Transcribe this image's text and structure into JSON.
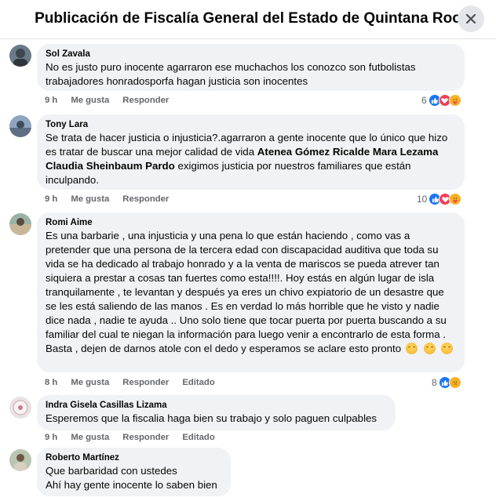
{
  "header": {
    "title": "Publicación de Fiscalía General del Estado de Quintana Roo"
  },
  "actions": {
    "like": "Me gusta",
    "reply": "Responder",
    "edited": "Editado"
  },
  "comments": [
    {
      "author": "Sol Zavala",
      "text": "No es justo puro inocente agarraron ese muchachos los conozco son futbolistas trabajadores honradosporfa hagan justicia son inocentes",
      "time": "9 h",
      "reaction_count": "6",
      "reactions": [
        "like-icon",
        "love-icon",
        "care-icon"
      ]
    },
    {
      "author": "Tony Lara",
      "text_before": "Se trata de hacer justicia o injusticia?.agarraron a gente inocente que lo único que hizo es tratar de buscar una mejor calidad de vida ",
      "mention1": "Atenea Gómez Ricalde",
      "mention2": "Mara Lezama",
      "mention3": "Claudia Sheinbaum Pardo",
      "text_after": " exigimos justicia por nuestros familiares que están inculpando.",
      "time": "9 h",
      "reaction_count": "10",
      "reactions": [
        "like-icon",
        "love-icon",
        "care-icon"
      ]
    },
    {
      "author": "Romi Aime",
      "text": "Es una barbarie , una injusticia y una pena lo que están haciendo , como vas a pretender que una persona de la tercera edad con discapacidad auditiva que toda su vida se ha dedicado al trabajo honrado y a la venta de mariscos se pueda atrever tan siquiera a prestar a cosas tan fuertes como esta!!!!. Hoy estás en algún lugar de isla tranquilamente , te levantan y después ya eres un chivo expiatorio de un desastre que se les está saliendo de las manos . Es en verdad lo más horrible que he visto y nadie dice nada , nadie te ayuda .. Uno solo tiene que tocar puerta por puerta buscando a su familiar del cual te niegan la información para luego venir a encontrarlo de esta forma . Basta , dejen de darnos atole con el dedo y esperamos se aclare esto pronto",
      "time": "8 h",
      "reaction_count": "8",
      "reactions": [
        "like-icon",
        "sad-icon"
      ]
    },
    {
      "author": "Indra Gisela Casillas Lizama",
      "text": "Esperemos que la fiscalia haga bien su trabajo y solo paguen culpables",
      "time": "9 h"
    },
    {
      "author": "Roberto Martínez",
      "line1": "Que barbaridad con ustedes",
      "line2": "Ahí hay gente inocente lo saben bien"
    }
  ]
}
